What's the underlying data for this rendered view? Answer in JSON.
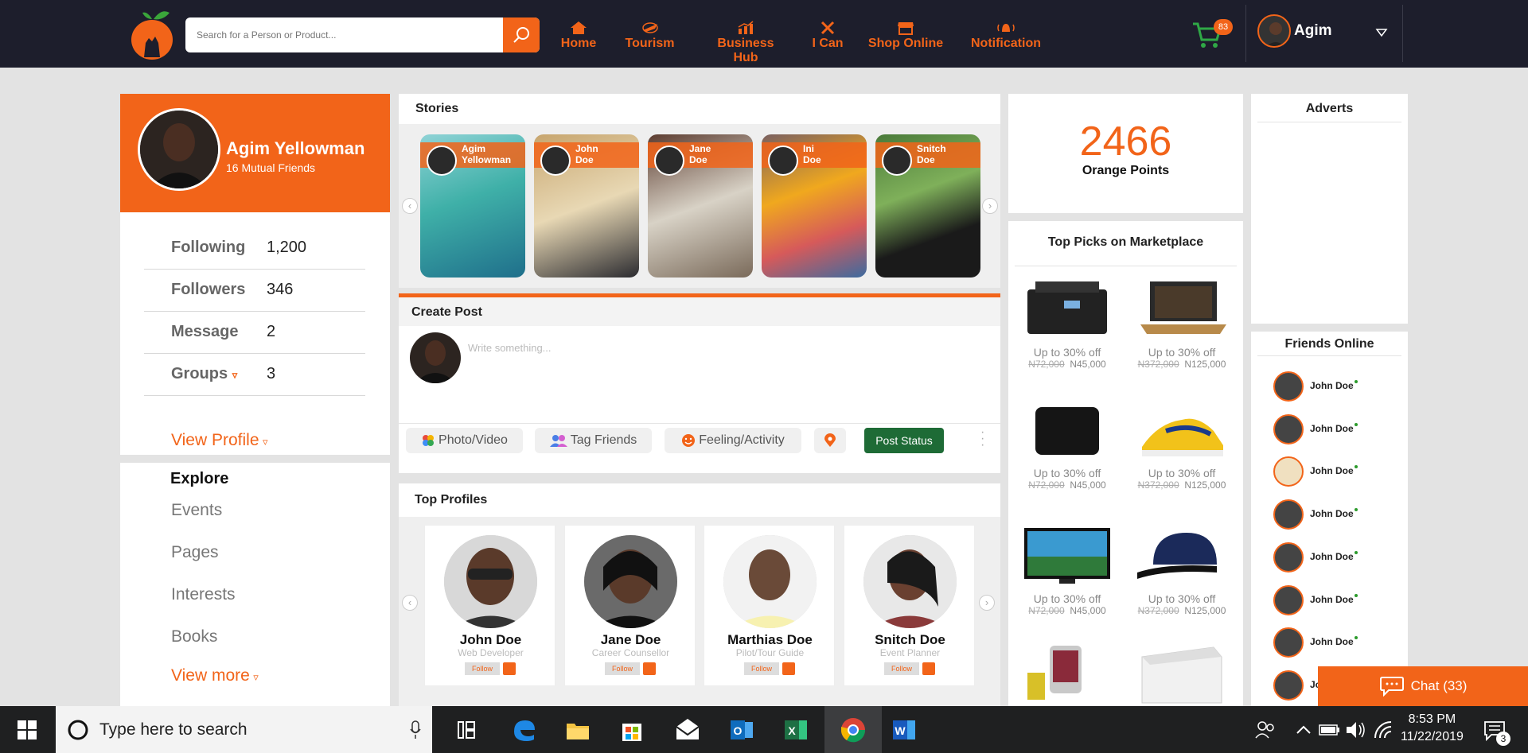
{
  "header": {
    "search_placeholder": "Search for a Person or Product...",
    "nav": [
      {
        "label": "Home",
        "icon": "home-icon"
      },
      {
        "label": "Tourism",
        "icon": "plane-icon"
      },
      {
        "label": "Business Hub",
        "icon": "chart-icon"
      },
      {
        "label": "I Can",
        "icon": "tools-icon"
      },
      {
        "label": "Shop Online",
        "icon": "store-icon"
      },
      {
        "label": "Notification",
        "icon": "bell-icon"
      }
    ],
    "cart_count": "83",
    "user_name": "Agim"
  },
  "profile": {
    "name": "Agim Yellowman",
    "mutual": "16 Mutual Friends",
    "stats": [
      {
        "label": "Following",
        "value": "1,200"
      },
      {
        "label": "Followers",
        "value": "346"
      },
      {
        "label": "Message",
        "value": "2"
      },
      {
        "label": "Groups",
        "value": "3"
      }
    ],
    "view_profile": "View Profile"
  },
  "explore": {
    "title": "Explore",
    "items": [
      "Events",
      "Pages",
      "Interests",
      "Books"
    ],
    "view_more": "View more"
  },
  "stories": {
    "title": "Stories",
    "items": [
      {
        "first": "Agim",
        "last": "Yellowman"
      },
      {
        "first": "John",
        "last": "Doe"
      },
      {
        "first": "Jane",
        "last": "Doe"
      },
      {
        "first": "Ini",
        "last": "Doe"
      },
      {
        "first": "Snitch",
        "last": "Doe"
      }
    ]
  },
  "create_post": {
    "title": "Create Post",
    "placeholder": "Write something...",
    "photo": "Photo/Video",
    "tag": "Tag Friends",
    "feeling": "Feeling/Activity",
    "post": "Post Status"
  },
  "top_profiles": {
    "title": "Top Profiles",
    "follow": "Follow",
    "items": [
      {
        "name": "John Doe",
        "role": "Web Developer"
      },
      {
        "name": "Jane Doe",
        "role": "Career Counsellor"
      },
      {
        "name": "Marthias Doe",
        "role": "Pilot/Tour Guide"
      },
      {
        "name": "Snitch Doe",
        "role": "Event Planner"
      }
    ]
  },
  "points": {
    "value": "2466",
    "label": "Orange Points"
  },
  "marketplace": {
    "title": "Top Picks on Marketplace",
    "items": [
      {
        "off": "Up to 30% off",
        "old": "N72,000",
        "new": "N45,000"
      },
      {
        "off": "Up to 30% off",
        "old": "N372,000",
        "new": "N125,000"
      },
      {
        "off": "Up to 30% off",
        "old": "N72,000",
        "new": "N45,000"
      },
      {
        "off": "Up to 30% off",
        "old": "N372,000",
        "new": "N125,000"
      },
      {
        "off": "Up to 30% off",
        "old": "N72,000",
        "new": "N45,000"
      },
      {
        "off": "Up to 30% off",
        "old": "N372,000",
        "new": "N125,000"
      }
    ]
  },
  "adverts": {
    "title": "Adverts"
  },
  "friends_online": {
    "title": "Friends Online",
    "items": [
      "John Doe",
      "John Doe",
      "John Doe",
      "John Doe",
      "John Doe",
      "John Doe",
      "John Doe",
      "Jo"
    ]
  },
  "chat": {
    "label": "Chat (33)"
  },
  "taskbar": {
    "search": "Type here to search",
    "time": "8:53 PM",
    "date": "11/22/2019",
    "notif_count": "3"
  },
  "colors": {
    "accent": "#f26419",
    "header_bg": "#1d1e2c",
    "online": "#2c9b2c"
  }
}
